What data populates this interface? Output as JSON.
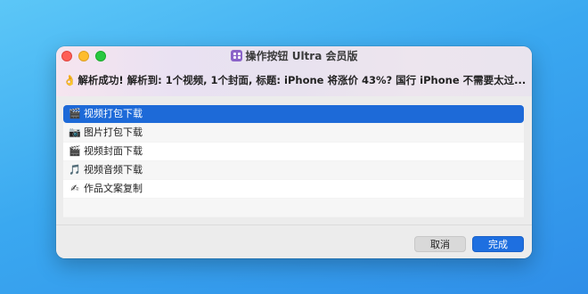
{
  "window": {
    "title": "操作按钮 Ultra 会员版",
    "app_icon": "shortcuts-app-icon"
  },
  "message": {
    "icon": "ok-hand-emoji",
    "hand": "👌",
    "text": "解析成功! 解析到: 1个视频, 1个封面, 标题: iPhone 将涨价 43%? 国行 iPhone 不需要太过..."
  },
  "list": {
    "items": [
      {
        "icon": "🎬",
        "icon_name": "clapper-board-icon",
        "label": "视频打包下载",
        "selected": true
      },
      {
        "icon": "📷",
        "icon_name": "camera-icon",
        "label": "图片打包下载",
        "selected": false
      },
      {
        "icon": "🎬",
        "icon_name": "clapper-board-icon",
        "label": "视频封面下载",
        "selected": false
      },
      {
        "icon": "🎵",
        "icon_name": "music-note-icon",
        "label": "视频音频下载",
        "selected": false
      },
      {
        "icon": "✍",
        "icon_name": "writing-hand-icon",
        "label": "作品文案复制",
        "selected": false
      }
    ]
  },
  "buttons": {
    "cancel": "取消",
    "done": "完成"
  },
  "colors": {
    "background": "#3aa8f0",
    "selection": "#1d6ad8",
    "primary_button": "#1e6fe0"
  }
}
